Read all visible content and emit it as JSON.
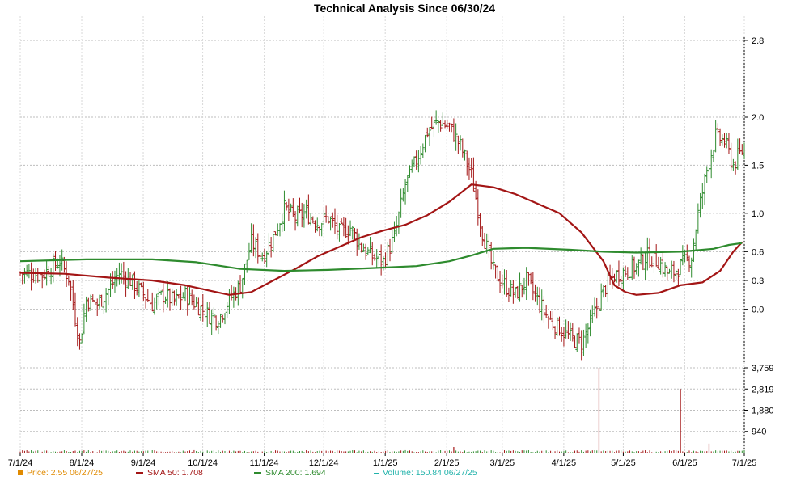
{
  "title": "Technical Analysis Since 06/30/24",
  "chart_data": {
    "type": "ohlc",
    "x_ticks": [
      "7/1/24",
      "8/1/24",
      "9/1/24",
      "10/1/24",
      "11/1/24",
      "12/1/24",
      "1/1/25",
      "2/1/25",
      "3/1/25",
      "4/1/25",
      "5/1/25",
      "6/1/25",
      "7/1/25"
    ],
    "y_ticks": [
      "0.0",
      "0.3",
      "0.6",
      "1.0",
      "1.5",
      "2.0",
      "2.8"
    ],
    "volume_ticks": [
      "940",
      "1,880",
      "2,819",
      "3,759"
    ],
    "price_range": [
      -0.55,
      2.85
    ],
    "volume_range": [
      0,
      3759
    ],
    "price_closes": [
      {
        "x": 0,
        "close": 0.38
      },
      {
        "x": 10,
        "close": 0.36
      },
      {
        "x": 18,
        "close": 0.5
      },
      {
        "x": 22,
        "close": 0.33
      },
      {
        "x": 27,
        "close": -0.35
      },
      {
        "x": 30,
        "close": 0.1
      },
      {
        "x": 35,
        "close": 0.05
      },
      {
        "x": 40,
        "close": 0.2
      },
      {
        "x": 45,
        "close": 0.38
      },
      {
        "x": 50,
        "close": 0.3
      },
      {
        "x": 55,
        "close": 0.18
      },
      {
        "x": 60,
        "close": 0.05
      },
      {
        "x": 65,
        "close": 0.15
      },
      {
        "x": 70,
        "close": 0.08
      },
      {
        "x": 75,
        "close": 0.15
      },
      {
        "x": 80,
        "close": 0.05
      },
      {
        "x": 85,
        "close": -0.05
      },
      {
        "x": 90,
        "close": -0.1
      },
      {
        "x": 95,
        "close": 0.1
      },
      {
        "x": 100,
        "close": 0.25
      },
      {
        "x": 105,
        "close": 0.7
      },
      {
        "x": 110,
        "close": 0.55
      },
      {
        "x": 115,
        "close": 0.75
      },
      {
        "x": 120,
        "close": 1.05
      },
      {
        "x": 125,
        "close": 0.95
      },
      {
        "x": 130,
        "close": 1.0
      },
      {
        "x": 135,
        "close": 0.9
      },
      {
        "x": 140,
        "close": 0.95
      },
      {
        "x": 145,
        "close": 0.8
      },
      {
        "x": 150,
        "close": 0.85
      },
      {
        "x": 155,
        "close": 0.65
      },
      {
        "x": 160,
        "close": 0.55
      },
      {
        "x": 165,
        "close": 0.5
      },
      {
        "x": 170,
        "close": 0.75
      },
      {
        "x": 175,
        "close": 1.3
      },
      {
        "x": 180,
        "close": 1.55
      },
      {
        "x": 185,
        "close": 1.85
      },
      {
        "x": 190,
        "close": 1.95
      },
      {
        "x": 195,
        "close": 1.9
      },
      {
        "x": 200,
        "close": 1.7
      },
      {
        "x": 205,
        "close": 1.4
      },
      {
        "x": 210,
        "close": 0.8
      },
      {
        "x": 215,
        "close": 0.4
      },
      {
        "x": 220,
        "close": 0.25
      },
      {
        "x": 225,
        "close": 0.15
      },
      {
        "x": 230,
        "close": 0.3
      },
      {
        "x": 235,
        "close": 0.1
      },
      {
        "x": 240,
        "close": -0.1
      },
      {
        "x": 245,
        "close": -0.2
      },
      {
        "x": 250,
        "close": -0.3
      },
      {
        "x": 255,
        "close": -0.35
      },
      {
        "x": 260,
        "close": -0.1
      },
      {
        "x": 265,
        "close": 0.2
      },
      {
        "x": 270,
        "close": 0.35
      },
      {
        "x": 275,
        "close": 0.4
      },
      {
        "x": 280,
        "close": 0.45
      },
      {
        "x": 285,
        "close": 0.55
      },
      {
        "x": 290,
        "close": 0.5
      },
      {
        "x": 295,
        "close": 0.35
      },
      {
        "x": 300,
        "close": 0.45
      },
      {
        "x": 305,
        "close": 0.55
      },
      {
        "x": 308,
        "close": 1.0
      },
      {
        "x": 312,
        "close": 1.45
      },
      {
        "x": 316,
        "close": 1.8
      },
      {
        "x": 320,
        "close": 1.75
      },
      {
        "x": 324,
        "close": 1.5
      },
      {
        "x": 328,
        "close": 1.65
      }
    ],
    "series": [
      {
        "name": "SMA 50",
        "color": "#a31515",
        "points": [
          {
            "x": 0,
            "y": 0.38
          },
          {
            "x": 20,
            "y": 0.37
          },
          {
            "x": 40,
            "y": 0.33
          },
          {
            "x": 60,
            "y": 0.3
          },
          {
            "x": 75,
            "y": 0.25
          },
          {
            "x": 85,
            "y": 0.2
          },
          {
            "x": 95,
            "y": 0.15
          },
          {
            "x": 105,
            "y": 0.18
          },
          {
            "x": 115,
            "y": 0.3
          },
          {
            "x": 125,
            "y": 0.42
          },
          {
            "x": 135,
            "y": 0.55
          },
          {
            "x": 145,
            "y": 0.65
          },
          {
            "x": 155,
            "y": 0.75
          },
          {
            "x": 165,
            "y": 0.82
          },
          {
            "x": 175,
            "y": 0.88
          },
          {
            "x": 185,
            "y": 0.98
          },
          {
            "x": 195,
            "y": 1.12
          },
          {
            "x": 205,
            "y": 1.3
          },
          {
            "x": 215,
            "y": 1.27
          },
          {
            "x": 225,
            "y": 1.2
          },
          {
            "x": 235,
            "y": 1.1
          },
          {
            "x": 245,
            "y": 1.0
          },
          {
            "x": 255,
            "y": 0.8
          },
          {
            "x": 265,
            "y": 0.5
          },
          {
            "x": 270,
            "y": 0.25
          },
          {
            "x": 275,
            "y": 0.18
          },
          {
            "x": 280,
            "y": 0.15
          },
          {
            "x": 290,
            "y": 0.17
          },
          {
            "x": 300,
            "y": 0.25
          },
          {
            "x": 310,
            "y": 0.28
          },
          {
            "x": 318,
            "y": 0.4
          },
          {
            "x": 324,
            "y": 0.6
          },
          {
            "x": 328,
            "y": 0.7
          }
        ]
      },
      {
        "name": "SMA 200",
        "color": "#2e8b2e",
        "points": [
          {
            "x": 0,
            "y": 0.5
          },
          {
            "x": 30,
            "y": 0.52
          },
          {
            "x": 60,
            "y": 0.52
          },
          {
            "x": 80,
            "y": 0.49
          },
          {
            "x": 100,
            "y": 0.42
          },
          {
            "x": 120,
            "y": 0.4
          },
          {
            "x": 140,
            "y": 0.41
          },
          {
            "x": 160,
            "y": 0.43
          },
          {
            "x": 180,
            "y": 0.45
          },
          {
            "x": 195,
            "y": 0.5
          },
          {
            "x": 205,
            "y": 0.56
          },
          {
            "x": 215,
            "y": 0.63
          },
          {
            "x": 230,
            "y": 0.64
          },
          {
            "x": 250,
            "y": 0.62
          },
          {
            "x": 265,
            "y": 0.6
          },
          {
            "x": 280,
            "y": 0.59
          },
          {
            "x": 300,
            "y": 0.6
          },
          {
            "x": 315,
            "y": 0.63
          },
          {
            "x": 322,
            "y": 0.67
          },
          {
            "x": 328,
            "y": 0.69
          }
        ]
      }
    ],
    "volume_spikes": [
      {
        "x": 263,
        "volume": 3759
      },
      {
        "x": 300,
        "volume": 2819
      },
      {
        "x": 197,
        "volume": 250
      },
      {
        "x": 313,
        "volume": 400
      }
    ],
    "legend": [
      {
        "label": "Price: 2.55  06/27/25",
        "color": "#e08a00",
        "marker": "square"
      },
      {
        "label": "SMA 50: 1.708",
        "color": "#a31515",
        "marker": "line"
      },
      {
        "label": "SMA 200: 1.694",
        "color": "#2e8b2e",
        "marker": "line"
      },
      {
        "label": "Volume: 150.84  06/27/25",
        "color": "#20b2aa",
        "marker": "dash"
      }
    ],
    "xlabel": "",
    "ylabel": "",
    "grid": true,
    "legend_position": "bottom"
  }
}
